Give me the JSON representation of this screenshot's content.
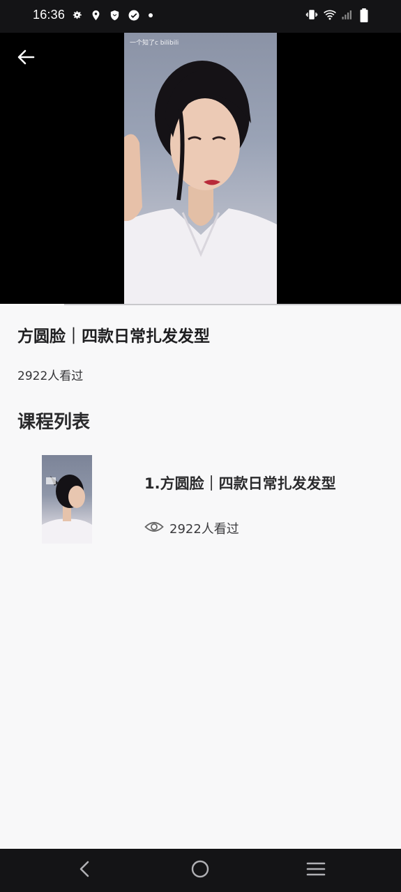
{
  "status_bar": {
    "time": "16:36",
    "left_icons": [
      "gear-icon",
      "location-icon",
      "shield-icon",
      "check-circle-icon",
      "dot-icon"
    ],
    "right_icons": [
      "vibrate-icon",
      "wifi-icon",
      "signal-icon",
      "battery-icon"
    ]
  },
  "video": {
    "watermark": "一个知了c bilibili"
  },
  "course": {
    "title": "方圆脸｜四款日常扎发发型",
    "views": "2922人看过"
  },
  "section": {
    "title": "课程列表"
  },
  "lessons": [
    {
      "title": "1.方圆脸｜四款日常扎发发型",
      "views": "2922人看过"
    }
  ],
  "nav": {
    "icons": [
      "nav-back-icon",
      "nav-home-icon",
      "nav-menu-icon"
    ]
  },
  "colors": {
    "background": "#f8f8f9",
    "status_bar": "#141416",
    "video_bg": "#000000",
    "text_primary": "#1e1e20"
  }
}
